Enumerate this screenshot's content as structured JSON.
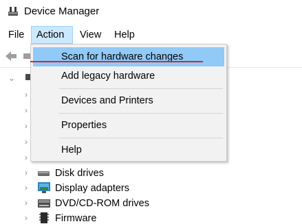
{
  "window": {
    "title": "Device Manager",
    "icon": "device-manager-icon"
  },
  "menubar": {
    "items": [
      {
        "label": "File",
        "active": false
      },
      {
        "label": "Action",
        "active": true
      },
      {
        "label": "View",
        "active": false
      },
      {
        "label": "Help",
        "active": false
      }
    ]
  },
  "toolbar": {
    "buttons": [
      "back-arrow-icon",
      "forward-icon"
    ]
  },
  "action_menu": {
    "items": [
      {
        "label": "Scan for hardware changes",
        "highlighted": true
      },
      {
        "label": "Add legacy hardware"
      },
      {
        "label": "Devices and Printers"
      },
      {
        "label": "Properties"
      },
      {
        "label": "Help"
      }
    ],
    "highlight_color": "#91c9f7",
    "annotation_color": "#d9252b"
  },
  "tree": {
    "visible_nodes": [
      {
        "label": "Disk drives",
        "icon": "disk-drive-icon"
      },
      {
        "label": "Display adapters",
        "icon": "display-adapter-icon"
      },
      {
        "label": "DVD/CD-ROM drives",
        "icon": "dvd-drive-icon"
      },
      {
        "label": "Firmware",
        "icon": "firmware-chip-icon"
      }
    ]
  }
}
